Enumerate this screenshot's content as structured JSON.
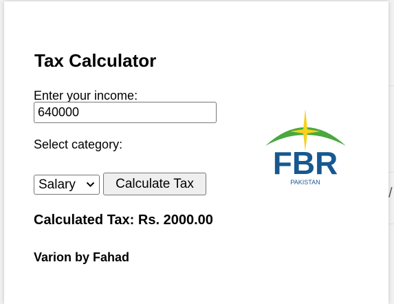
{
  "calculator": {
    "title": "Tax Calculator",
    "income_label": "Enter your income:",
    "income_value": "640000",
    "category_label": "Select category:",
    "category_selected": "Salary",
    "calculate_label": "Calculate Tax",
    "result_text": "Calculated Tax: Rs. 2000.00",
    "credit_text": "Varion by Fahad"
  },
  "background": {
    "glyph": "/"
  },
  "logo": {
    "name": "fbr-logo",
    "text": "FBR",
    "subtext": "PAKISTAN",
    "colors": {
      "text": "#17588f",
      "arc": "#4aa83e",
      "star": "#f6d21e"
    }
  }
}
